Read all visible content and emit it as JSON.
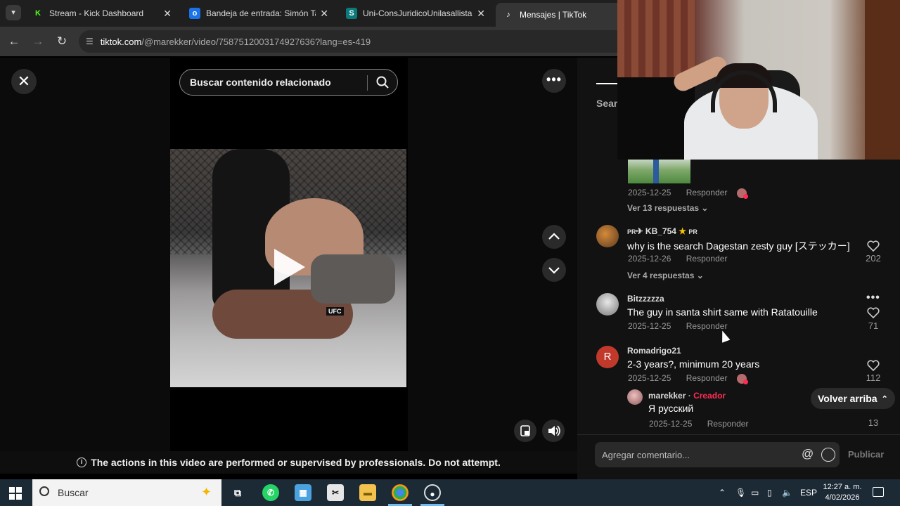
{
  "browser": {
    "tabs": [
      {
        "title": "Stream - Kick Dashboard",
        "favicon": "kick-icon",
        "active": false
      },
      {
        "title": "Bandeja de entrada: Simón Tab",
        "favicon": "outlook-icon",
        "active": false
      },
      {
        "title": "Uni-ConsJuridicoUnilasallista - ",
        "favicon": "sharepoint-icon",
        "active": false
      },
      {
        "title": "Mensajes | TikTok",
        "favicon": "tiktok-icon",
        "active": true
      }
    ],
    "url_host": "tiktok.com",
    "url_path": "/@marekker/video/7587512003174927636?lang=es-419"
  },
  "video": {
    "search_placeholder": "Buscar contenido relacionado",
    "disclaimer": "The actions in this video are performed or supervised by professionals. Do not attempt.",
    "tags": [
      "UFC"
    ]
  },
  "comments_panel": {
    "search_tab_partial": "Sear",
    "top_reply_meta": {
      "date": "2025-12-25",
      "reply": "Responder"
    },
    "top_more_replies": "Ver 13 respuestas",
    "comments": [
      {
        "name": "KB_754",
        "name_prefix": "PR",
        "name_suffix": "PR",
        "text": "why is the search Dagestan zesty guy [ステッカー]",
        "date": "2025-12-26",
        "reply": "Responder",
        "likes": "202",
        "more_replies": "Ver 4 respuestas"
      },
      {
        "name": "Bitzzzzza",
        "text": "The guy in santa shirt same with Ratatouille",
        "date": "2025-12-25",
        "reply": "Responder",
        "likes": "71"
      },
      {
        "name": "Romadrigo21",
        "avatar_letter": "R",
        "text": "2-3 years?, minimum 20 years",
        "date": "2025-12-25",
        "reply": "Responder",
        "likes": "112"
      }
    ],
    "nested_reply": {
      "name": "marekker",
      "separator": " · ",
      "badge": "Creador",
      "text": "Я русский",
      "date": "2025-12-25",
      "reply": "Responder",
      "likes": "13"
    },
    "back_to_top": "Volver arriba",
    "comment_placeholder": "Agregar comentario...",
    "publish": "Publicar"
  },
  "taskbar": {
    "search_placeholder": "Buscar",
    "language": "ESP",
    "time": "12:27 a. m.",
    "date": "4/02/2026"
  },
  "colors": {
    "tiktok_red": "#fe2c55",
    "kick_green": "#53fc18",
    "panel_bg": "#121212",
    "taskbar_bg": "#1c2a36"
  }
}
